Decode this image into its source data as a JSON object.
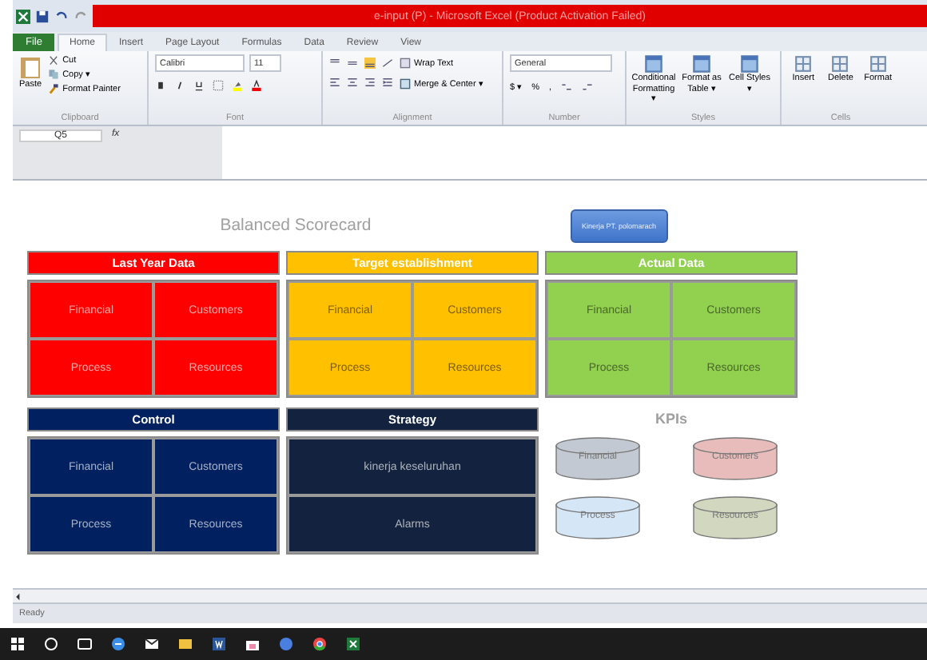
{
  "window": {
    "title": "e-input (P) - Microsoft Excel (Product Activation Failed)"
  },
  "ribbon": {
    "file_tab": "File",
    "tabs": [
      {
        "label": "Home",
        "selected": true
      },
      {
        "label": "Insert",
        "selected": false
      },
      {
        "label": "Page Layout",
        "selected": false
      },
      {
        "label": "Formulas",
        "selected": false
      },
      {
        "label": "Data",
        "selected": false
      },
      {
        "label": "Review",
        "selected": false
      },
      {
        "label": "View",
        "selected": false
      }
    ],
    "clipboard": {
      "paste": "Paste",
      "cut": "Cut",
      "copy": "Copy ▾",
      "format_painter": "Format Painter",
      "label": "Clipboard"
    },
    "font": {
      "name": "Calibri",
      "size": "11",
      "label": "Font"
    },
    "alignment": {
      "wrap": "Wrap Text",
      "merge": "Merge & Center ▾",
      "label": "Alignment"
    },
    "number": {
      "format": "General",
      "currency": "$ ▾",
      "percent": "%",
      "comma": ",",
      "label": "Number"
    },
    "styles": {
      "items": [
        "Conditional Formatting ▾",
        "Format as Table ▾",
        "Cell Styles ▾"
      ],
      "label": "Styles"
    },
    "cells": {
      "items": [
        "Insert",
        "Delete",
        "Format"
      ],
      "label": "Cells"
    }
  },
  "formula_bar": {
    "name_box": "Q5",
    "fx": "fx"
  },
  "sheet": {
    "title": "Balanced Scorecard",
    "button": "Kinerja PT. polomarach",
    "panels": [
      {
        "kind": "grid",
        "title": "Last Year Data",
        "color": "#ff0000",
        "cells": [
          "Financial",
          "Customers",
          "Process",
          "Resources"
        ]
      },
      {
        "kind": "grid",
        "title": "Target establishment",
        "color": "#ffc000",
        "cells": [
          "Financial",
          "Customers",
          "Process",
          "Resources"
        ]
      },
      {
        "kind": "grid",
        "title": "Actual Data",
        "color": "#92d050",
        "cells": [
          "Financial",
          "Customers",
          "Process",
          "Resources"
        ]
      },
      {
        "kind": "grid",
        "title": "Control",
        "color": "#002060",
        "cells": [
          "Financial",
          "Customers",
          "Process",
          "Resources"
        ]
      },
      {
        "kind": "rows",
        "title": "Strategy",
        "color": "#13233f",
        "cells": [
          "kinerja keseluruhan",
          "Alarms"
        ]
      }
    ],
    "kpis": {
      "title": "KPIs",
      "items": [
        {
          "label": "Financial",
          "color": "#c3c9d2"
        },
        {
          "label": "Customers",
          "color": "#e9bcbc"
        },
        {
          "label": "Process",
          "color": "#d5e6f6"
        },
        {
          "label": "Resources",
          "color": "#d2d8bf"
        }
      ]
    }
  },
  "status_bar": {
    "text": "Ready"
  }
}
